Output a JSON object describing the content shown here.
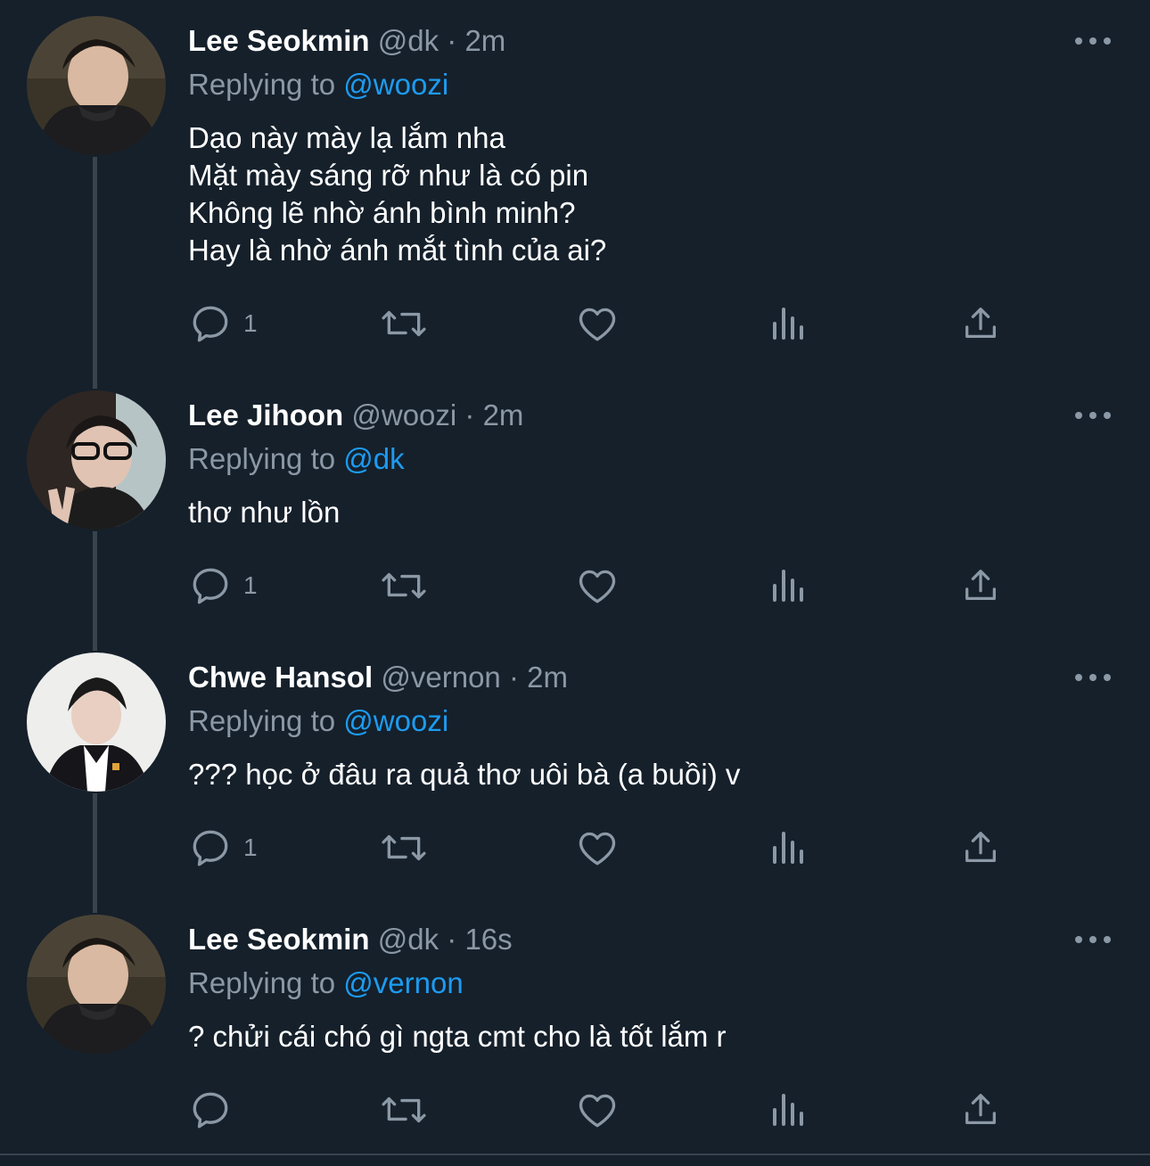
{
  "colors": {
    "background": "#15202b",
    "text": "#ffffff",
    "muted": "#8b98a5",
    "accent": "#1d9bf0",
    "thread_line": "#38444d"
  },
  "tweets": [
    {
      "name": "Lee Seokmin",
      "handle": "@dk",
      "separator": "·",
      "time": "2m",
      "reply_prefix": "Replying to",
      "reply_to": "@woozi",
      "text": "Dạo này mày lạ lắm nha\nMặt mày sáng rỡ như là có pin\nKhông lẽ nhờ ánh bình minh?\nHay là nhờ ánh mắt tình của ai?",
      "reply_count": "1",
      "avatar_icon": "profile-photo"
    },
    {
      "name": "Lee Jihoon",
      "handle": "@woozi",
      "separator": "·",
      "time": "2m",
      "reply_prefix": "Replying to",
      "reply_to": "@dk",
      "text": "thơ như lồn",
      "reply_count": "1",
      "avatar_icon": "profile-photo"
    },
    {
      "name": "Chwe Hansol",
      "handle": "@vernon",
      "separator": "·",
      "time": "2m",
      "reply_prefix": "Replying to",
      "reply_to": "@woozi",
      "text": "??? học ở đâu ra quả thơ uôi bà (a buồi) v",
      "reply_count": "1",
      "avatar_icon": "profile-photo"
    },
    {
      "name": "Lee Seokmin",
      "handle": "@dk",
      "separator": "·",
      "time": "16s",
      "reply_prefix": "Replying to",
      "reply_to": "@vernon",
      "text": "? chửi cái chó gì ngta cmt cho là tốt lắm r",
      "reply_count": "",
      "avatar_icon": "profile-photo"
    }
  ],
  "action_icons": [
    "reply-icon",
    "retweet-icon",
    "like-icon",
    "views-icon",
    "share-icon"
  ]
}
